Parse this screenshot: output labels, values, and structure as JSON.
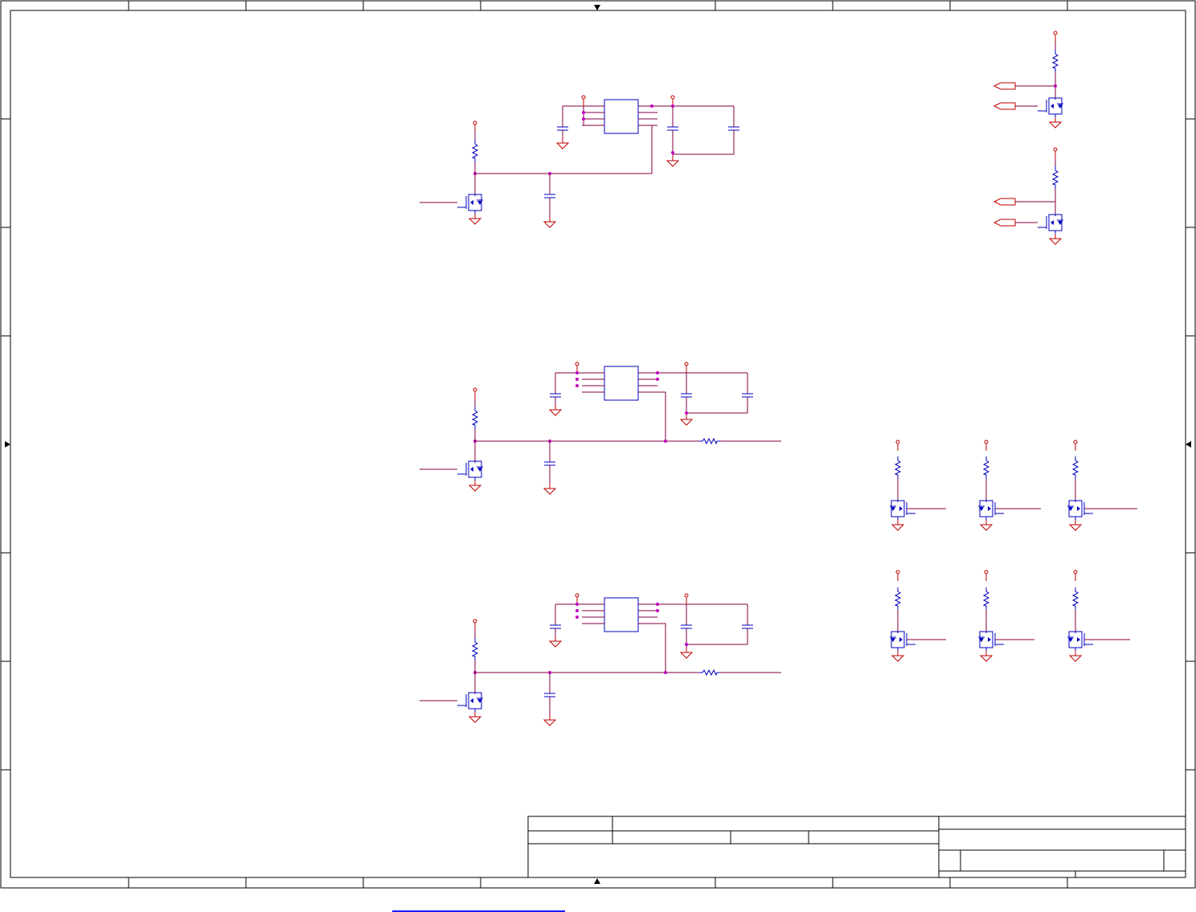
{
  "document": {
    "type": "schematic-sheet",
    "frame_color": "#000000",
    "wire_color": "#800040",
    "power_color": "#c00000",
    "component_color": "#0000c0",
    "junction_color": "#c000c0",
    "link_color": "#1a1aff"
  },
  "title_block": {
    "cells": []
  },
  "icons": {
    "mosfet": "mosfet-icon",
    "resistor": "resistor-icon",
    "capacitor": "capacitor-icon",
    "ground": "ground-icon",
    "power": "power-port-icon",
    "ic": "ic-chip-icon",
    "port": "port-arrow-icon"
  }
}
